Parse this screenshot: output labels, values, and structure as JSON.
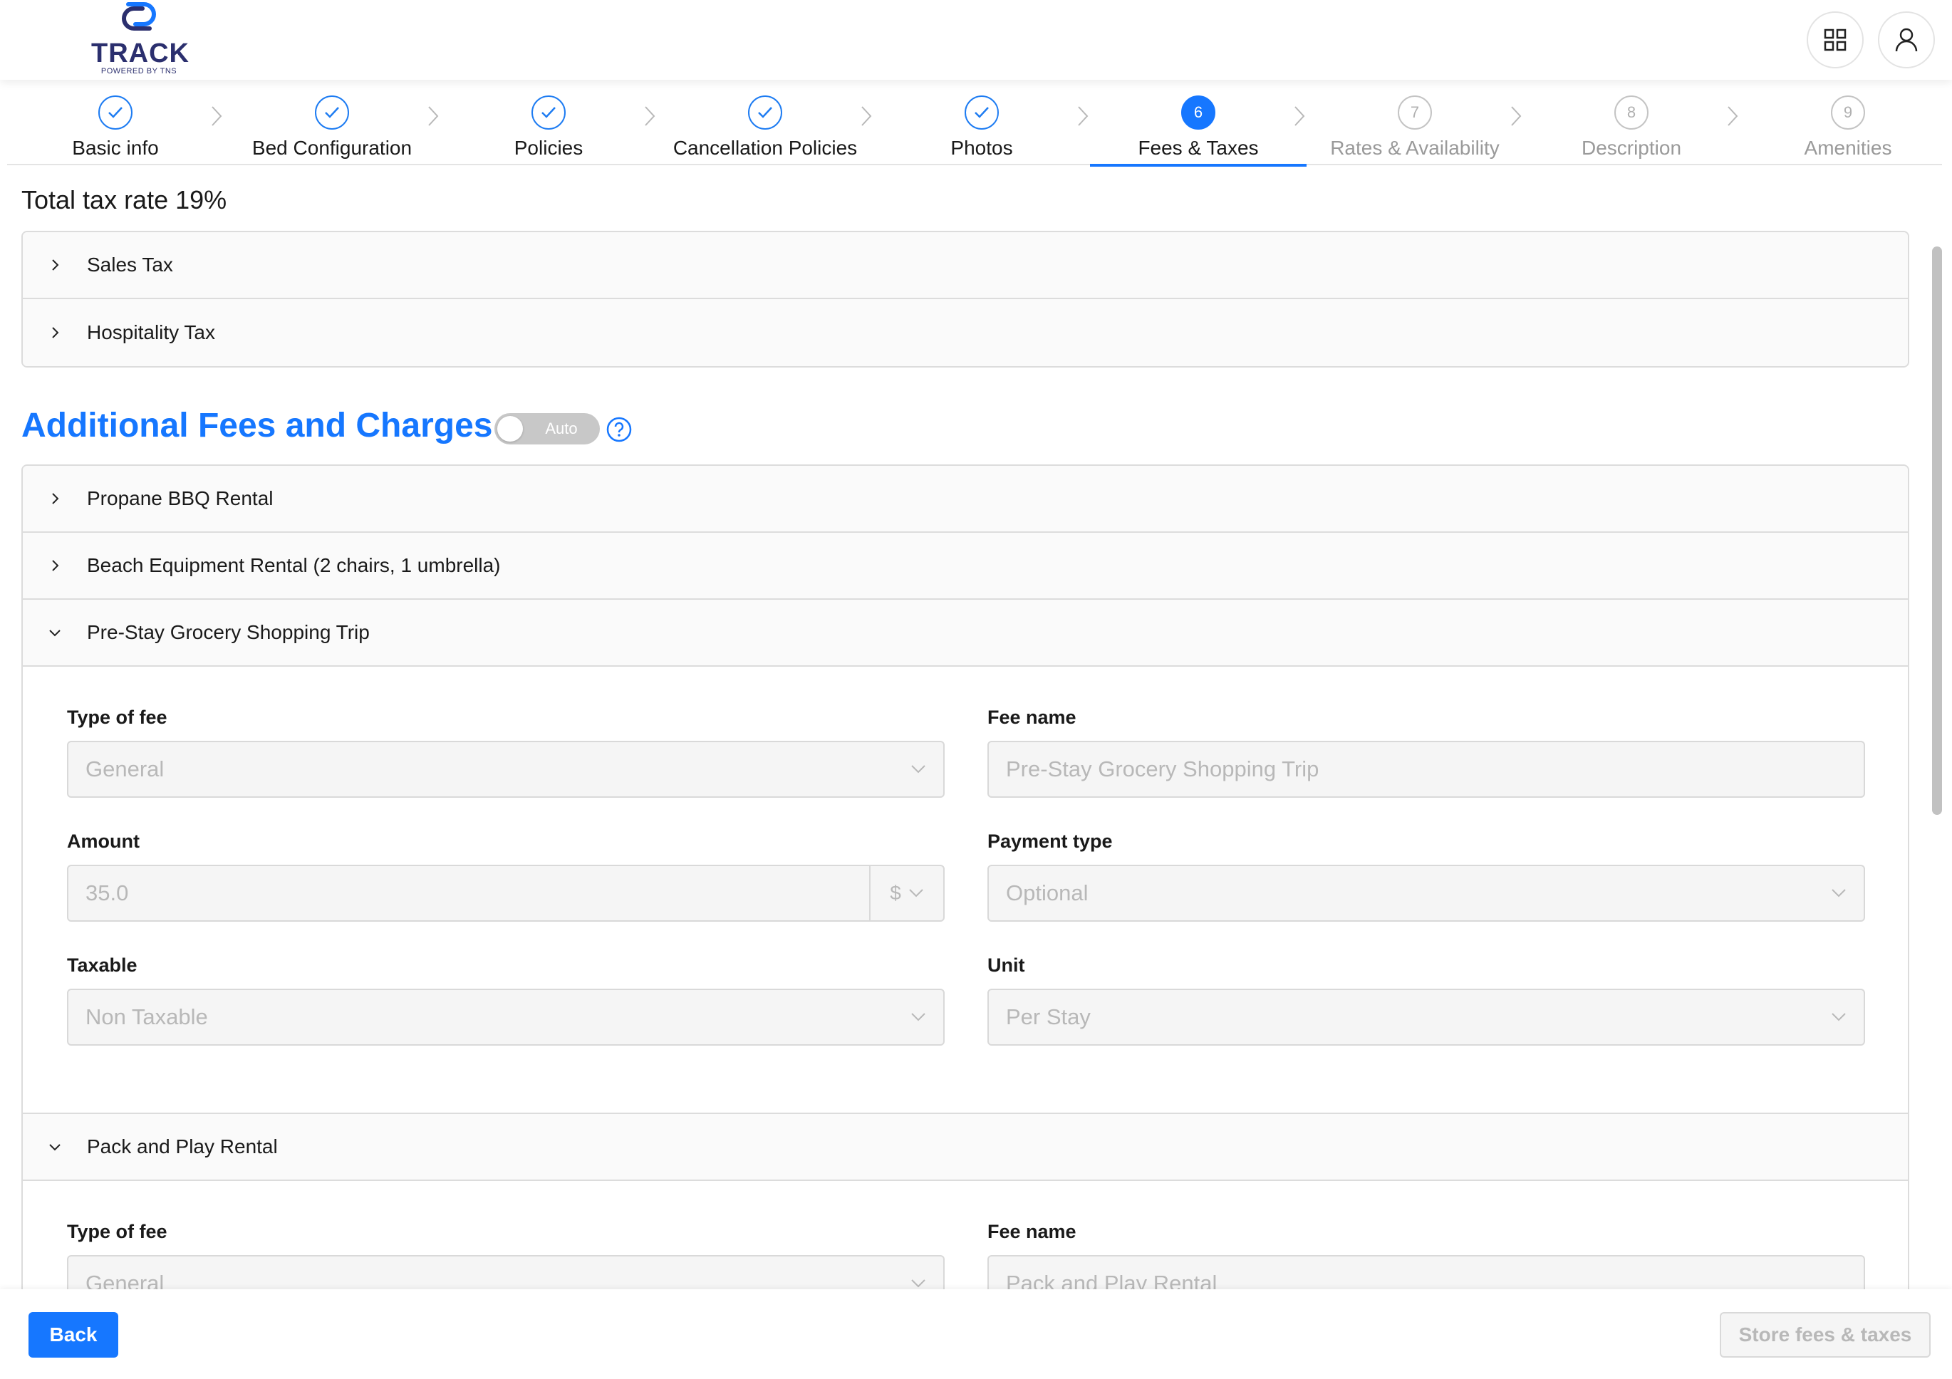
{
  "header": {
    "logo_text": "TRACK",
    "logo_sub": "POWERED BY TNS",
    "apps_icon": "grid-icon",
    "user_icon": "user-icon"
  },
  "stepper": {
    "steps": [
      {
        "number": "1",
        "label": "Basic info",
        "state": "done"
      },
      {
        "number": "2",
        "label": "Bed Configuration",
        "state": "done"
      },
      {
        "number": "3",
        "label": "Policies",
        "state": "done"
      },
      {
        "number": "4",
        "label": "Cancellation Policies",
        "state": "done"
      },
      {
        "number": "5",
        "label": "Photos",
        "state": "done"
      },
      {
        "number": "6",
        "label": "Fees & Taxes",
        "state": "active"
      },
      {
        "number": "7",
        "label": "Rates & Availability",
        "state": "todo"
      },
      {
        "number": "8",
        "label": "Description",
        "state": "todo"
      },
      {
        "number": "9",
        "label": "Amenities",
        "state": "todo"
      }
    ]
  },
  "taxes": {
    "total_label": "Total tax rate 19%",
    "items": [
      {
        "title": "Sales Tax",
        "expanded": false
      },
      {
        "title": "Hospitality Tax",
        "expanded": false
      }
    ]
  },
  "fees": {
    "title": "Additional Fees and Charges",
    "toggle_label": "Auto",
    "toggle_on": false,
    "help_icon": "question-circle-icon",
    "items": [
      {
        "title": "Propane BBQ Rental",
        "expanded": false
      },
      {
        "title": "Beach Equipment Rental (2 chairs, 1 umbrella)",
        "expanded": false
      },
      {
        "title": "Pre-Stay Grocery Shopping Trip",
        "expanded": true,
        "form": {
          "type_of_fee": {
            "label": "Type of fee",
            "value": "General"
          },
          "fee_name": {
            "label": "Fee name",
            "value": "Pre-Stay Grocery Shopping Trip"
          },
          "amount": {
            "label": "Amount",
            "value": "35.0",
            "currency": "$"
          },
          "payment_type": {
            "label": "Payment type",
            "value": "Optional"
          },
          "taxable": {
            "label": "Taxable",
            "value": "Non Taxable"
          },
          "unit": {
            "label": "Unit",
            "value": "Per Stay"
          }
        }
      },
      {
        "title": "Pack and Play Rental",
        "expanded": true,
        "form": {
          "type_of_fee": {
            "label": "Type of fee",
            "value": "General"
          },
          "fee_name": {
            "label": "Fee name",
            "value": "Pack and Play Rental"
          }
        }
      }
    ]
  },
  "footer": {
    "back_label": "Back",
    "store_label": "Store fees & taxes"
  },
  "colors": {
    "accent": "#1677ff",
    "disabled_text": "#b8b8b8",
    "border": "#d9d9d9"
  }
}
